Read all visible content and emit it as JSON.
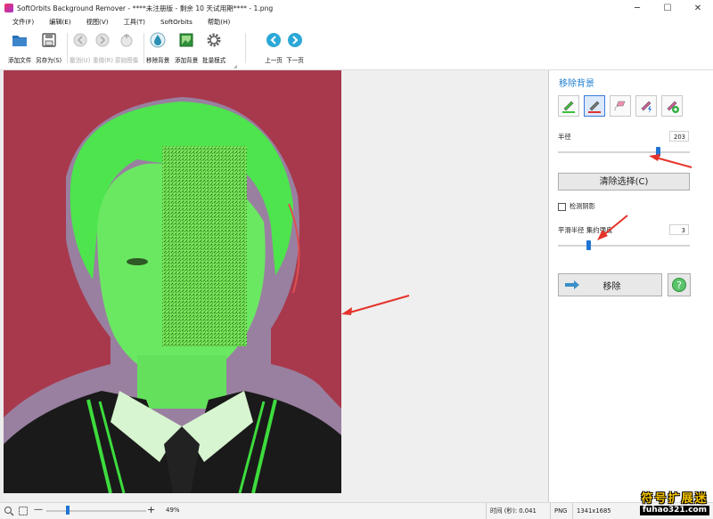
{
  "window": {
    "title": "SoftOrbits Background Remover - ****未注册版 - 剩余 10 天试用期**** - 1.png",
    "minimize": "─",
    "maximize": "☐",
    "close": "✕"
  },
  "menu": [
    "文件(F)",
    "编辑(E)",
    "视图(V)",
    "工具(T)",
    "SoftOrbits",
    "帮助(H)"
  ],
  "toolbar": {
    "add_file": "添加文件",
    "save_as": "另存为(S)",
    "undo": "撤消(U)",
    "redo": "重做(R)",
    "original": "原始图像",
    "remove_bg": "移除背景",
    "add_bg": "添加背景",
    "batch": "批量模式",
    "prev": "上一页",
    "next": "下一页"
  },
  "panel": {
    "title": "移除背景",
    "radius_label": "半径",
    "radius_value": "203",
    "radius_fraction": 0.76,
    "clear_label": "清除选择(C)",
    "shadow_label": "检测阴影",
    "smooth_label": "平滑半径 集约强度",
    "smooth_value": "3",
    "smooth_fraction": 0.23,
    "remove_label": "移除"
  },
  "status": {
    "zoom_minus": "—",
    "zoom_plus": "+",
    "zoom": "49%",
    "time": "时间 (秒): 0.041",
    "format": "PNG",
    "size": "1341x1685"
  },
  "watermark": {
    "line1": "符号扩展迷",
    "line2": "fuhao321.com"
  },
  "colors": {
    "accent": "#1f74d4",
    "background": "#a8394d",
    "foreground_mask": "#4de44d",
    "annotation_arrow": "#e5332a"
  }
}
